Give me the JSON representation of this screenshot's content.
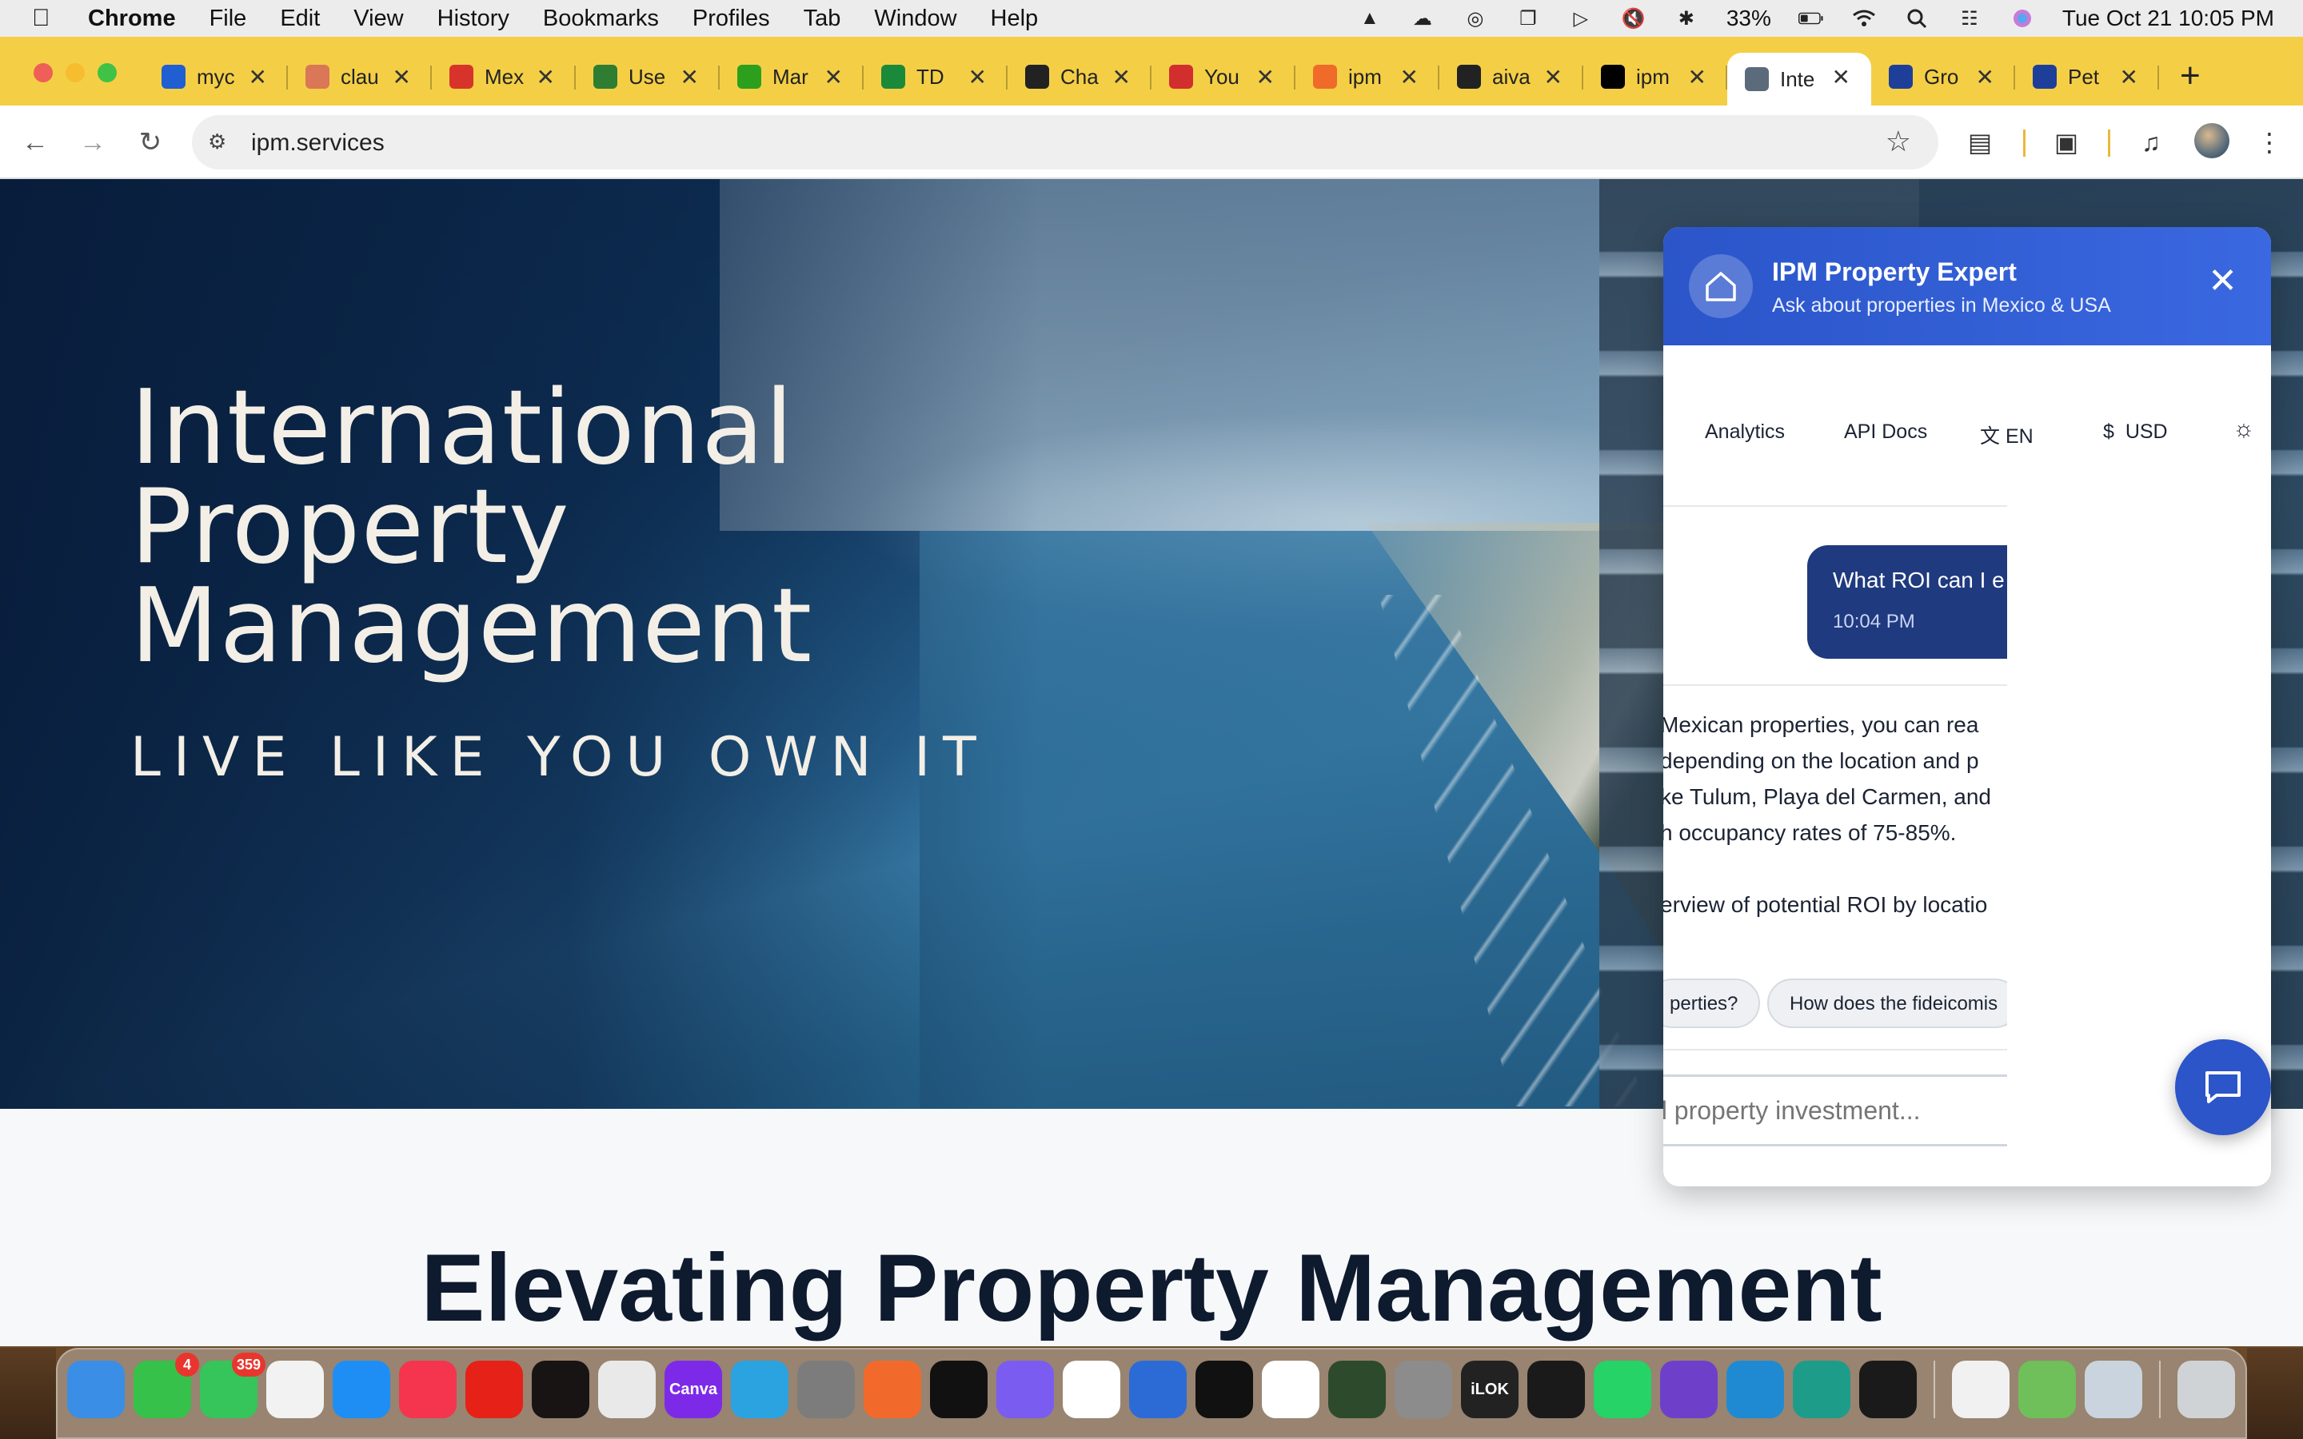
{
  "menubar": {
    "app": "Chrome",
    "items": [
      "File",
      "Edit",
      "View",
      "History",
      "Bookmarks",
      "Profiles",
      "Tab",
      "Window",
      "Help"
    ],
    "battery": "33%",
    "datetime": "Tue Oct 21  10:05 PM"
  },
  "tabs": [
    {
      "title": "myc",
      "favicon": "house-icon",
      "color": "#1f5fd1"
    },
    {
      "title": "clau",
      "favicon": "claude-icon",
      "color": "#d97757"
    },
    {
      "title": "Mex",
      "favicon": "mexico-icon",
      "color": "#d8332b"
    },
    {
      "title": "Use",
      "favicon": "spark-icon",
      "color": "#2e7d32"
    },
    {
      "title": "Mar",
      "favicon": "qb-icon",
      "color": "#2ca01c"
    },
    {
      "title": "TD",
      "favicon": "td-icon",
      "color": "#1a8a3a"
    },
    {
      "title": "Cha",
      "favicon": "openai-icon",
      "color": "#222222"
    },
    {
      "title": "You",
      "favicon": "arrow-icon",
      "color": "#d22e2e"
    },
    {
      "title": "ipm",
      "favicon": "grid-icon",
      "color": "#f06a2a"
    },
    {
      "title": "aiva",
      "favicon": "github-icon",
      "color": "#222222"
    },
    {
      "title": "ipm",
      "favicon": "vercel-icon",
      "color": "#000000"
    },
    {
      "title": "Inte",
      "favicon": "ipm-icon",
      "color": "#5b6b7b",
      "active": true
    },
    {
      "title": "Gro",
      "favicon": "b-icon",
      "color": "#1d3f9a"
    },
    {
      "title": "Pet",
      "favicon": "b-icon",
      "color": "#1d3f9a"
    }
  ],
  "toolbar": {
    "url": "ipm.services"
  },
  "hero": {
    "title_line1": "International",
    "title_line2": "Property",
    "title_line3": "Management",
    "tagline": "LIVE LIKE YOU OWN IT"
  },
  "section": {
    "title": "Elevating Property Management"
  },
  "chat": {
    "title": "IPM Property Expert",
    "subtitle": "Ask about properties in Mexico & USA",
    "nav": {
      "analytics": "Analytics",
      "api_docs": "API Docs",
      "language": "EN",
      "currency": "USD"
    },
    "user_message": "What ROI can I e",
    "user_time": "10:04 PM",
    "answer_lines": [
      " Mexican properties, you can rea",
      " depending on the location and p",
      "ke Tulum, Playa del Carmen, and",
      "h occupancy rates of 75-85%.",
      "",
      "erview of potential ROI by locatio"
    ],
    "chips": [
      "perties?",
      "How does the fideicomis"
    ],
    "input_placeholder": "al property investment..."
  },
  "dock": {
    "facetime_badge": "4",
    "messages_badge": "359",
    "apps": [
      {
        "name": "finder-icon",
        "color": "#3a8ee6",
        "label": ""
      },
      {
        "name": "facetime-icon",
        "color": "#36c24a",
        "label": ""
      },
      {
        "name": "messages-icon",
        "color": "#35c55a",
        "label": ""
      },
      {
        "name": "notes-icon",
        "color": "#f2f2f2",
        "label": ""
      },
      {
        "name": "appstore-icon",
        "color": "#1e8ef5",
        "label": ""
      },
      {
        "name": "music-icon",
        "color": "#f4354d",
        "label": ""
      },
      {
        "name": "youtube-icon",
        "color": "#e62117",
        "label": ""
      },
      {
        "name": "spotify-icon",
        "color": "#191414",
        "label": ""
      },
      {
        "name": "chrome-icon",
        "color": "#e9e9e9",
        "label": ""
      },
      {
        "name": "canva-icon",
        "color": "#7d2ae8",
        "label": "Canva"
      },
      {
        "name": "telegram-icon",
        "color": "#2aa3e0",
        "label": ""
      },
      {
        "name": "launchpad-icon",
        "color": "#7c7c7c",
        "label": ""
      },
      {
        "name": "screenrec-icon",
        "color": "#f26a2b",
        "label": ""
      },
      {
        "name": "capcut-icon",
        "color": "#111111",
        "label": ""
      },
      {
        "name": "bolt-icon",
        "color": "#7b5cf0",
        "label": ""
      },
      {
        "name": "link-icon",
        "color": "#ffffff",
        "label": ""
      },
      {
        "name": "audio-icon",
        "color": "#2c6bd6",
        "label": ""
      },
      {
        "name": "waves-icon",
        "color": "#111111",
        "label": ""
      },
      {
        "name": "slack-icon",
        "color": "#ffffff",
        "label": ""
      },
      {
        "name": "music-notes-icon",
        "color": "#2d4a2d",
        "label": ""
      },
      {
        "name": "settings-icon",
        "color": "#8c8c8c",
        "label": ""
      },
      {
        "name": "ilok-icon",
        "color": "#222222",
        "label": "iLOK"
      },
      {
        "name": "s-icon",
        "color": "#1a1a1a",
        "label": ""
      },
      {
        "name": "whatsapp-icon",
        "color": "#25d366",
        "label": ""
      },
      {
        "name": "github-desktop-icon",
        "color": "#6e40c9",
        "label": ""
      },
      {
        "name": "vscode-icon",
        "color": "#1f8ad2",
        "label": ""
      },
      {
        "name": "cursor-icon",
        "color": "#1e9c8a",
        "label": ""
      },
      {
        "name": "activity-icon",
        "color": "#1a1a1a",
        "label": ""
      },
      {
        "name": "keychain-icon",
        "color": "#f1f1f1",
        "label": ""
      },
      {
        "name": "maps-icon",
        "color": "#6fbf5a",
        "label": ""
      },
      {
        "name": "preview-icon",
        "color": "#c9d4de",
        "label": ""
      },
      {
        "name": "trash-icon",
        "color": "#cfd3d6",
        "label": ""
      }
    ]
  }
}
